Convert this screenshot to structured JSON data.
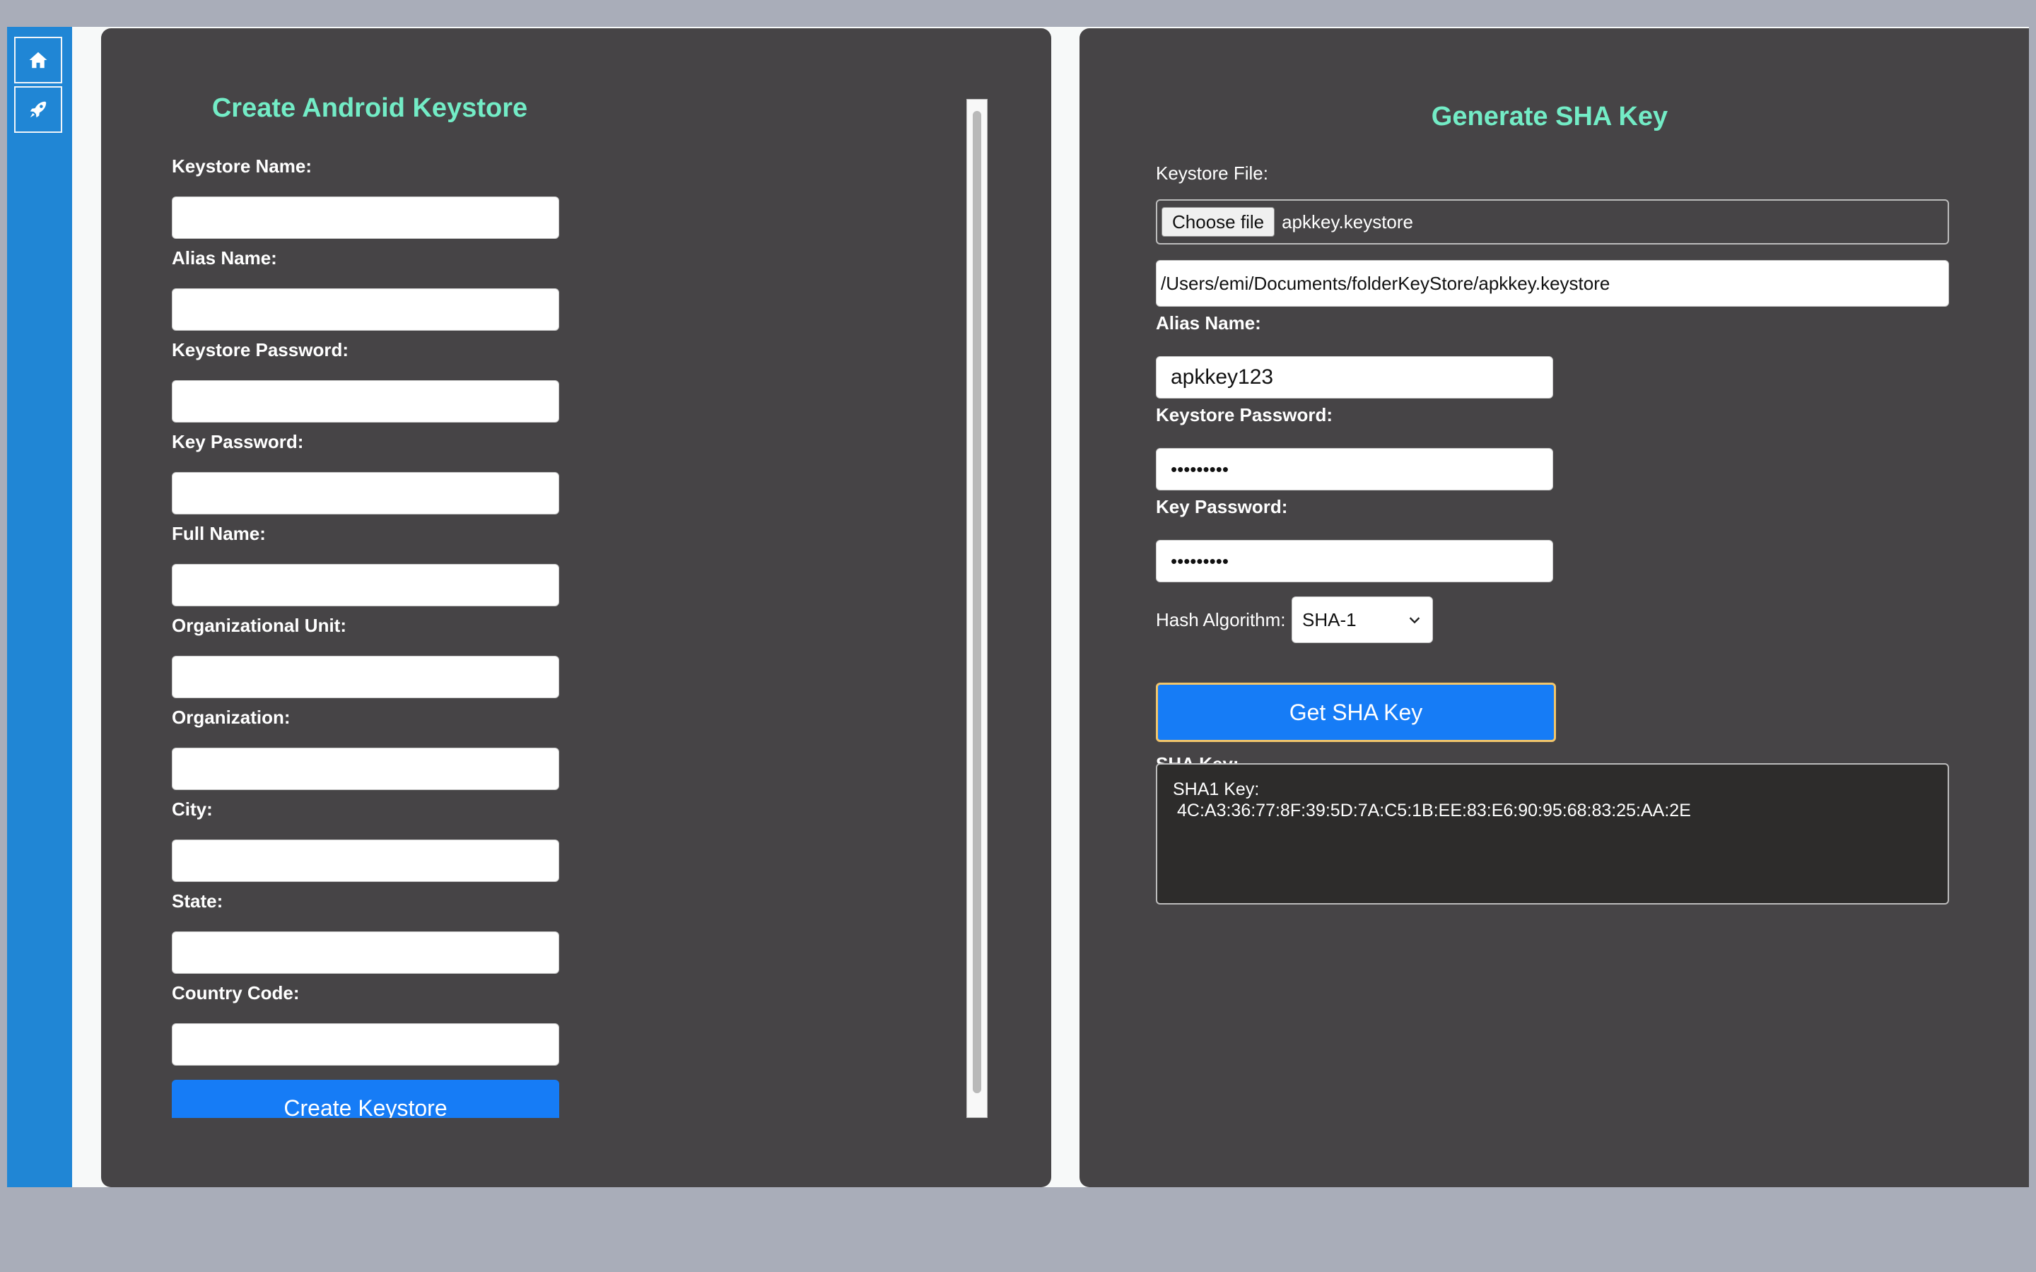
{
  "sidebar": {
    "icons": [
      "home-icon",
      "rocket-icon"
    ]
  },
  "create_panel": {
    "title": "Create Android Keystore",
    "fields": [
      {
        "label": "Keystore Name:",
        "value": ""
      },
      {
        "label": "Alias Name:",
        "value": ""
      },
      {
        "label": "Keystore Password:",
        "value": ""
      },
      {
        "label": "Key Password:",
        "value": ""
      },
      {
        "label": "Full Name:",
        "value": ""
      },
      {
        "label": "Organizational Unit:",
        "value": ""
      },
      {
        "label": "Organization:",
        "value": ""
      },
      {
        "label": "City:",
        "value": ""
      },
      {
        "label": "State:",
        "value": ""
      },
      {
        "label": "Country Code:",
        "value": ""
      }
    ],
    "submit_label": "Create Keystore"
  },
  "sha_panel": {
    "title": "Generate SHA Key",
    "file_label": "Keystore File:",
    "choose_file_label": "Choose file",
    "file_name": "apkkey.keystore",
    "file_path": "/Users/emi/Documents/folderKeyStore/apkkey.keystore",
    "alias_label": "Alias Name:",
    "alias_value": "apkkey123",
    "keystore_password_label": "Keystore Password:",
    "keystore_password_value": "•••••••••",
    "key_password_label": "Key Password:",
    "key_password_value": "•••••••••",
    "hash_label": "Hash Algorithm:",
    "hash_value": "SHA-1",
    "button_label": "Get SHA Key",
    "result_label": "SHA Key:",
    "result_line1": "SHA1 Key:",
    "result_line2": "4C:A3:36:77:8F:39:5D:7A:C5:1B:EE:83:E6:90:95:68:83:25:AA:2E"
  },
  "colors": {
    "page_bg": "#a9adb9",
    "sidebar_bg": "#2086d5",
    "panel_bg": "#464446",
    "title_accent": "#73ecc6",
    "primary_button": "#167cf6",
    "button_focus_ring": "#f1c56b",
    "output_bg": "#2d2c2b"
  }
}
